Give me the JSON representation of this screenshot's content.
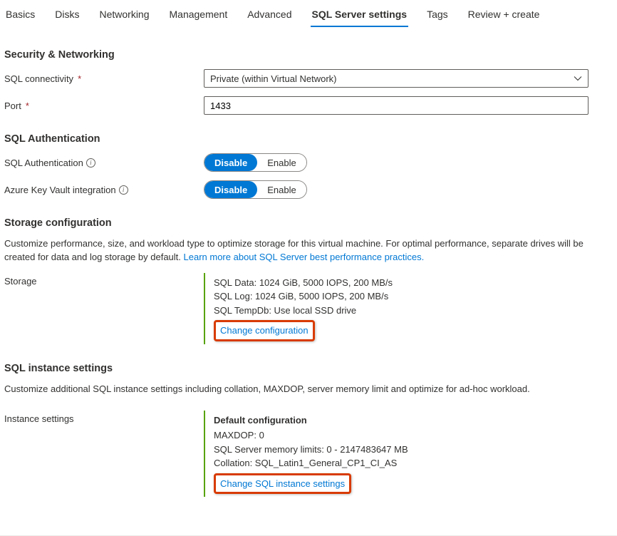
{
  "tabs": {
    "basics": "Basics",
    "disks": "Disks",
    "networking": "Networking",
    "management": "Management",
    "advanced": "Advanced",
    "sql": "SQL Server settings",
    "tags": "Tags",
    "review": "Review + create"
  },
  "security": {
    "heading": "Security & Networking",
    "connectivity_label": "SQL connectivity",
    "connectivity_value": "Private (within Virtual Network)",
    "port_label": "Port",
    "port_value": "1433"
  },
  "auth": {
    "heading": "SQL Authentication",
    "sqlauth_label": "SQL Authentication",
    "akv_label": "Azure Key Vault integration",
    "disable": "Disable",
    "enable": "Enable"
  },
  "storage": {
    "heading": "Storage configuration",
    "desc1": "Customize performance, size, and workload type to optimize storage for this virtual machine. For optimal performance, separate drives will be created for data and log storage by default. ",
    "learn_link": "Learn more about SQL Server best performance practices.",
    "label": "Storage",
    "line1": "SQL Data: 1024 GiB, 5000 IOPS, 200 MB/s",
    "line2": "SQL Log: 1024 GiB, 5000 IOPS, 200 MB/s",
    "line3": "SQL TempDb: Use local SSD drive",
    "change": "Change configuration"
  },
  "instance": {
    "heading": "SQL instance settings",
    "desc": "Customize additional SQL instance settings including collation, MAXDOP, server memory limit and optimize for ad-hoc workload.",
    "label": "Instance settings",
    "title": "Default configuration",
    "l1": "MAXDOP: 0",
    "l2": "SQL Server memory limits: 0 - 2147483647 MB",
    "l3": "Collation: SQL_Latin1_General_CP1_CI_AS",
    "change": "Change SQL instance settings"
  }
}
